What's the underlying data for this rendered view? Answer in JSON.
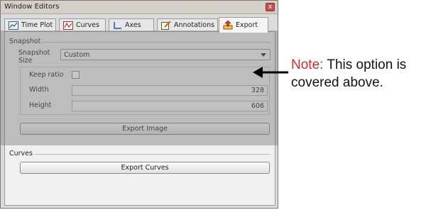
{
  "window": {
    "title": "Window Editors",
    "close_glyph": "x"
  },
  "tabs": [
    {
      "label": "Time Plot",
      "icon": "time-plot-icon",
      "active": false
    },
    {
      "label": "Curves",
      "icon": "curves-icon",
      "active": false
    },
    {
      "label": "Axes",
      "icon": "axes-icon",
      "active": false
    },
    {
      "label": "Annotations",
      "icon": "annotations-icon",
      "active": false
    },
    {
      "label": "Export",
      "icon": "export-icon",
      "active": true
    }
  ],
  "snapshot": {
    "group_label": "Snapshot",
    "size_label_line1": "Snapshot",
    "size_label_line2": "Size",
    "size_value": "Custom",
    "keep_ratio_label": "Keep ratio",
    "keep_ratio_checked": false,
    "width_label": "Width",
    "width_value": "328",
    "height_label": "Height",
    "height_value": "606",
    "export_button": "Export Image"
  },
  "curves": {
    "group_label": "Curves",
    "export_button": "Export Curves"
  },
  "annotation": {
    "prefix": "Note:",
    "text": "This option is covered above.",
    "prefix_color": "#d22b2b"
  }
}
